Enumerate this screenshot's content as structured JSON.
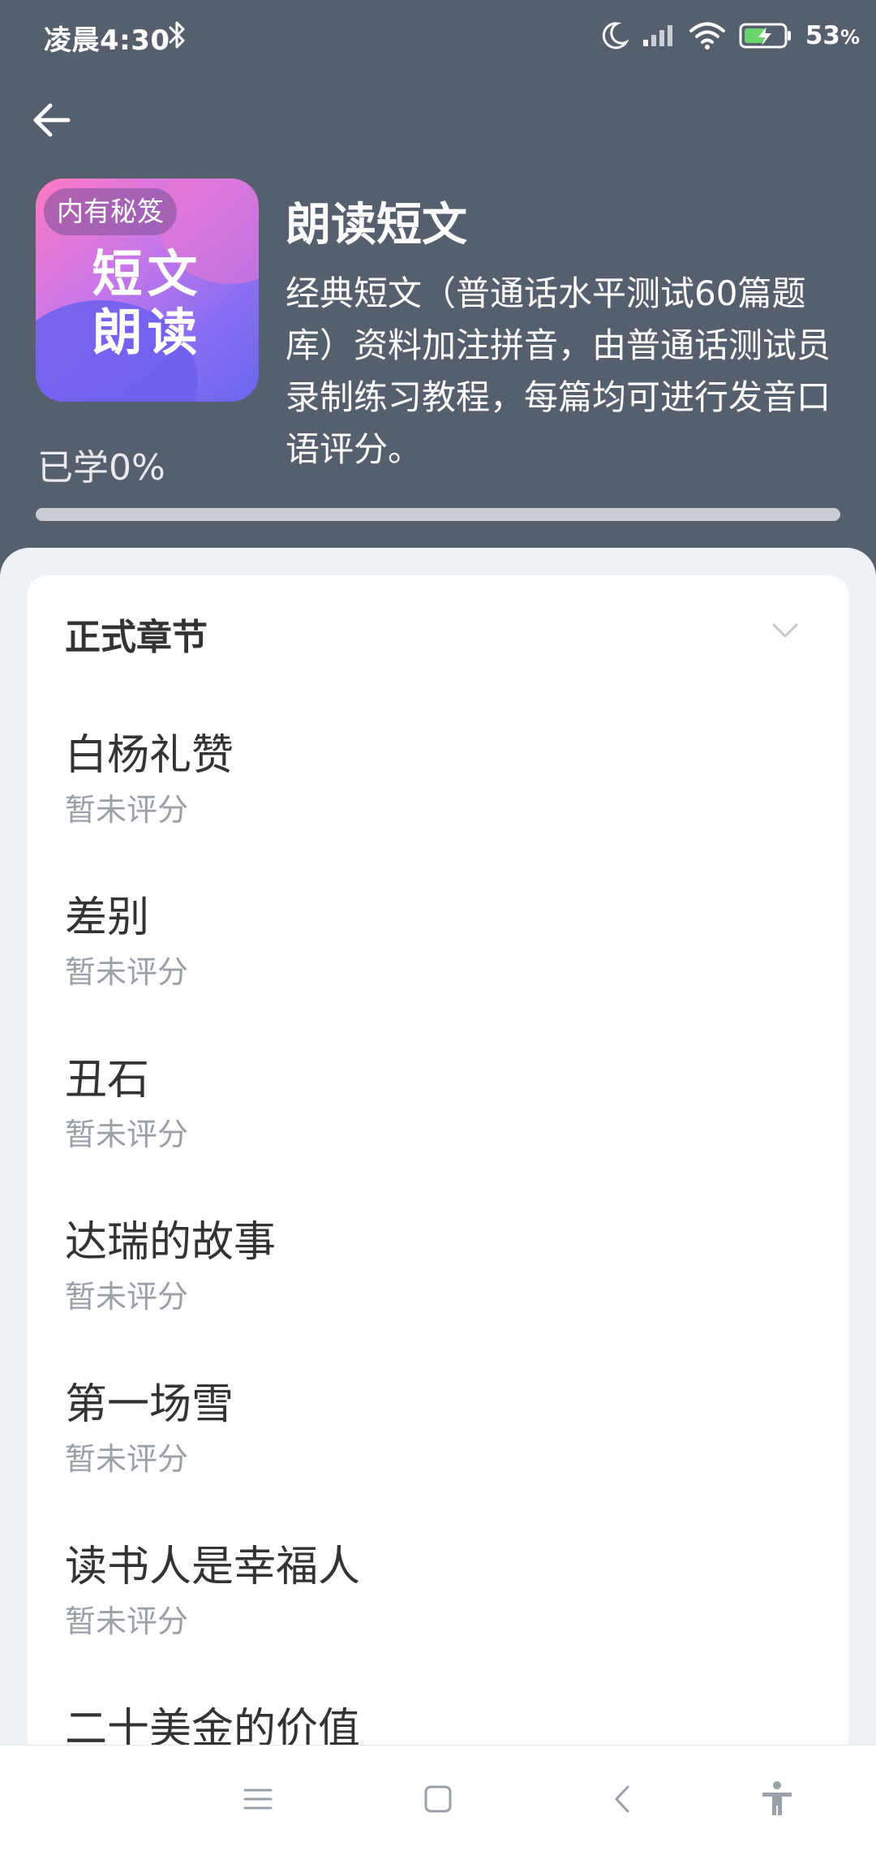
{
  "status_bar": {
    "time": "凌晨4:30",
    "battery_percent": "53",
    "battery_suffix": "%",
    "icons": [
      "bluetooth-icon",
      "moon-icon",
      "signal-icon",
      "wifi-icon",
      "battery-charging-icon"
    ]
  },
  "header": {
    "cover": {
      "tag": "内有秘笈",
      "title_line1": "短文",
      "title_line2": "朗读"
    },
    "title": "朗读短文",
    "description": "经典短文（普通话水平测试60篇题库）资料加注拼音，由普通话测试员录制练习教程，每篇均可进行发音口语评分。",
    "learned_label": "已学0%",
    "progress": 0.0
  },
  "section": {
    "title": "正式章节"
  },
  "chapters": [
    {
      "title": "白杨礼赞",
      "status": "暂未评分"
    },
    {
      "title": "差别",
      "status": "暂未评分"
    },
    {
      "title": "丑石",
      "status": "暂未评分"
    },
    {
      "title": "达瑞的故事",
      "status": "暂未评分"
    },
    {
      "title": "第一场雪",
      "status": "暂未评分"
    },
    {
      "title": "读书人是幸福人",
      "status": "暂未评分"
    },
    {
      "title": "二十美金的价值",
      "status": ""
    }
  ],
  "colors": {
    "header_bg": "#565f6e",
    "sheet_bg": "#eef1f5",
    "text_primary": "#333333",
    "text_secondary": "#9aa0a8"
  }
}
